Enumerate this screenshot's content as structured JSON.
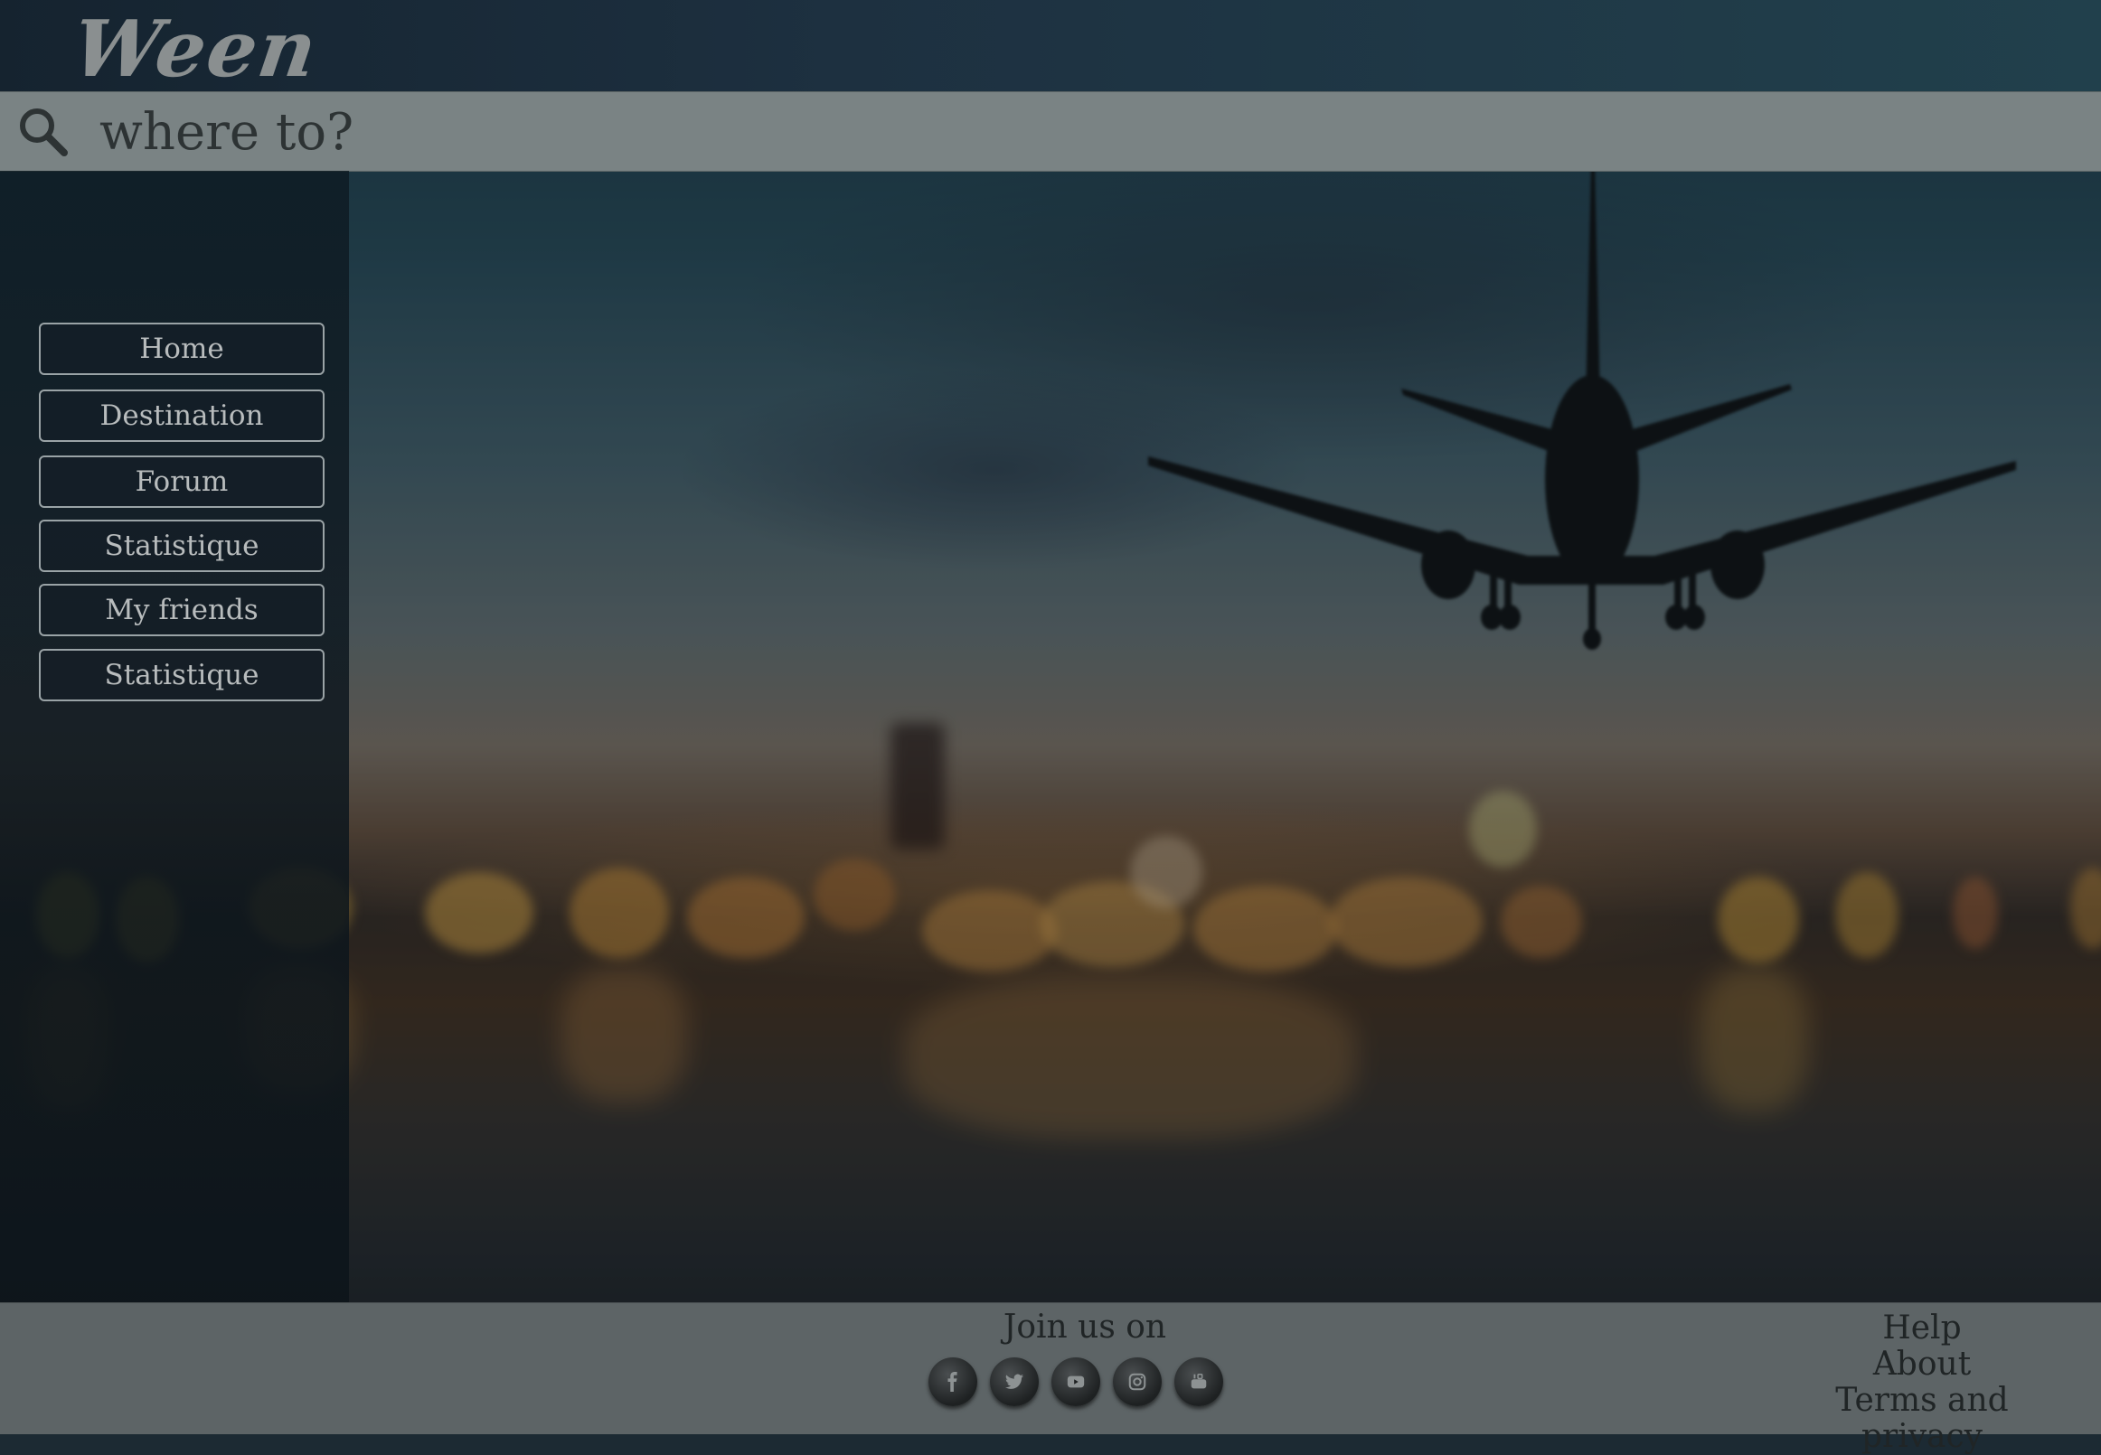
{
  "header": {
    "logo": "Ween"
  },
  "search": {
    "placeholder": "where to?"
  },
  "sidebar": {
    "items": [
      {
        "label": "Home"
      },
      {
        "label": "Destination"
      },
      {
        "label": "Forum"
      },
      {
        "label": "Statistique"
      },
      {
        "label": "My friends"
      },
      {
        "label": "Statistique"
      }
    ]
  },
  "footer": {
    "join_label": "Join us on",
    "social": [
      "facebook-icon",
      "twitter-icon",
      "youtube-icon",
      "instagram-icon",
      "youtube-legacy-icon"
    ],
    "links": [
      {
        "label": "Help"
      },
      {
        "label": "About"
      },
      {
        "label": "Terms and privacy"
      }
    ]
  },
  "colors": {
    "topbar": "#1d3040",
    "searchbar": "#7a8384",
    "footer": "#5d6466",
    "nav_border": "#9aa3a6"
  }
}
